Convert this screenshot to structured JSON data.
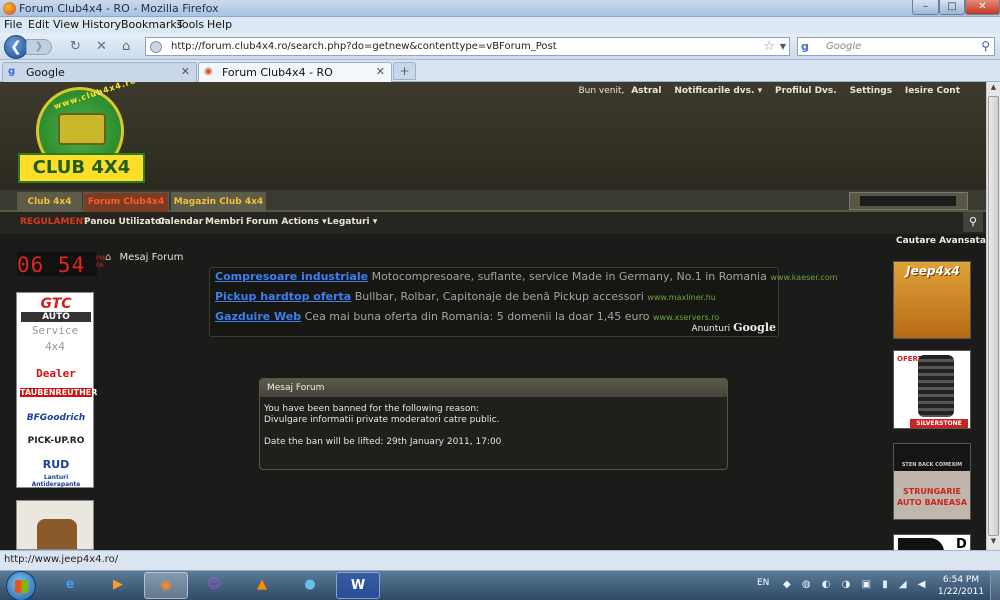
{
  "window": {
    "title": "Forum Club4x4 - RO - Mozilla Firefox",
    "min_glyph": "–",
    "max_glyph": "□",
    "close_glyph": "✕"
  },
  "menubar": {
    "items": [
      "File",
      "Edit",
      "View",
      "History",
      "Bookmarks",
      "Tools",
      "Help"
    ]
  },
  "navbar": {
    "back_glyph": "❮",
    "forward_glyph": "❯",
    "reload_glyph": "↻",
    "stop_glyph": "✕",
    "home_glyph": "⌂",
    "url": "http://forum.club4x4.ro/search.php?do=getnew&contenttype=vBForum_Post",
    "star_glyph": "☆",
    "dropdown_glyph": "▼",
    "search_placeholder": "Google",
    "search_engine_glyph": "g",
    "search_button_glyph": "⚲"
  },
  "tabs": [
    {
      "label": "Google",
      "active": false,
      "favicon_glyph": "g"
    },
    {
      "label": "Forum Club4x4 - RO",
      "active": true,
      "favicon_glyph": "◉"
    }
  ],
  "tab_close_glyph": "✕",
  "newtab_glyph": "+",
  "header": {
    "userlinks": {
      "greeting": "Bun venit,",
      "username": "Astral",
      "notifications": "Notificarile dvs. ▾",
      "profile": "Profilul Dvs.",
      "settings": "Settings",
      "logout": "Iesire Cont"
    },
    "logo": {
      "curve_text": "www.club4x4.ro",
      "name": "CLUB 4X4"
    }
  },
  "navtabs": [
    "Club 4x4",
    "Forum Club4x4",
    "Magazin Club 4x4"
  ],
  "subnav": {
    "items": [
      "REGULAMENT",
      "Panou Utilizator",
      "Calendar",
      "Membri",
      "Forum Actions ▾",
      "Legaturi ▾"
    ],
    "search_glyph": "⚲"
  },
  "advanced_search": "Cautare Avansata",
  "clock": {
    "digits": "06 54",
    "suffix_top": "PM",
    "suffix_bottom": "06"
  },
  "breadcrumb": {
    "home_glyph": "⌂",
    "label": "Mesaj Forum"
  },
  "ads": {
    "items": [
      {
        "title": "Compresoare industriale",
        "desc": "Motocompresoare, suflante, service Made in Germany, No.1 in Romania",
        "url": "www.kaeser.com"
      },
      {
        "title": "Pickup hardtop oferta",
        "desc": "Bullbar, Rolbar, Capitonaje de benă Pickup accessori",
        "url": "www.maxliner.hu"
      },
      {
        "title": "Gazduire Web",
        "desc": "Cea mai buna oferta din Romania: 5 domenii la doar 1,45 euro",
        "url": "www.xservers.ro"
      }
    ],
    "badge_label": "Anunturi",
    "badge_brand": "Google"
  },
  "message": {
    "header": "Mesaj Forum",
    "line1": "You have been banned for the following reason:",
    "line2": "Divulgare informatii private moderatori catre public.",
    "line3": "Date the ban will be lifted: 29th January 2011, 17:00"
  },
  "leftad": {
    "brand": "GTC",
    "auto": "AUTO",
    "service": "Service",
    "fourx4": "4x4",
    "dealer": "Dealer",
    "lines": [
      "TAUBENREUTHER",
      "BFGoodrich",
      "PICK-UP.RO",
      "RUD",
      "Lanturi Antiderapante"
    ]
  },
  "rightads": {
    "jeep": "Jeep4x4",
    "oferta": "OFERTA",
    "silverstone": "SILVERSTONE",
    "sten": "STEN BACK COMEXIM",
    "strungarie": "STRUNGARIE AUTO BANEASA",
    "d_letter": "D"
  },
  "scroll_up_glyph": "▲",
  "scroll_down_glyph": "▼",
  "statusbar": {
    "text": "http://www.jeep4x4.ro/"
  },
  "taskbar": {
    "apps": [
      {
        "icon": "ie-icon",
        "glyph": "e"
      },
      {
        "icon": "media-player-icon",
        "glyph": "▶"
      },
      {
        "icon": "firefox-icon",
        "glyph": "◉"
      },
      {
        "icon": "yahoo-messenger-icon",
        "glyph": "☺"
      },
      {
        "icon": "vlc-icon",
        "glyph": "▲"
      },
      {
        "icon": "orb-icon",
        "glyph": "●"
      },
      {
        "icon": "word-icon",
        "glyph": "W"
      }
    ],
    "lang": "EN",
    "tray_icons": "◆ ◍ ◐ ◑ ▣ ▮ ◢ ◀",
    "time": "6:54 PM",
    "date": "1/22/2011"
  }
}
